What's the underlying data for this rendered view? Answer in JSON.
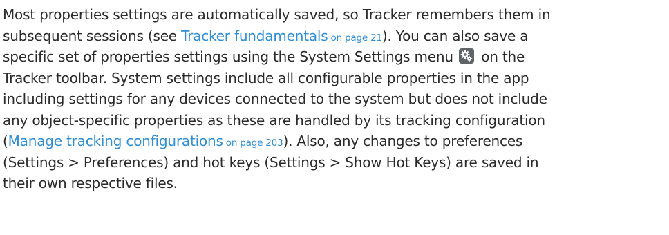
{
  "paragraph": {
    "l1": "Most properties settings are automatically saved, so Tracker remembers them in",
    "l2_a": "subsequent sessions (see ",
    "l2_link": "Tracker fundamentals",
    "l2_page": " on page 21",
    "l2_b": "). You can also save a",
    "l3_a": "specific set of properties settings using the System Settings menu",
    "l3_b": "on the",
    "l4": "Tracker toolbar. System settings include all configurable properties in the app",
    "l5": "including settings for any devices connected to the system but does not include",
    "l6": "any object-specific properties as these are handled by its tracking configuration",
    "l7_a": "(",
    "l7_link": "Manage tracking configurations",
    "l7_page": " on page 203",
    "l7_b": "). Also, any changes to preferences",
    "l8_a": "(Settings > Preferences) and hot keys (Settings > Show Hot Keys) are saved in",
    "l9": "their own respective files."
  },
  "icons": {
    "system_settings": "system-settings-gear-icon"
  },
  "colors": {
    "text": "#2b2b2b",
    "link": "#2e8fd6",
    "icon_bg": "#5e6468"
  }
}
